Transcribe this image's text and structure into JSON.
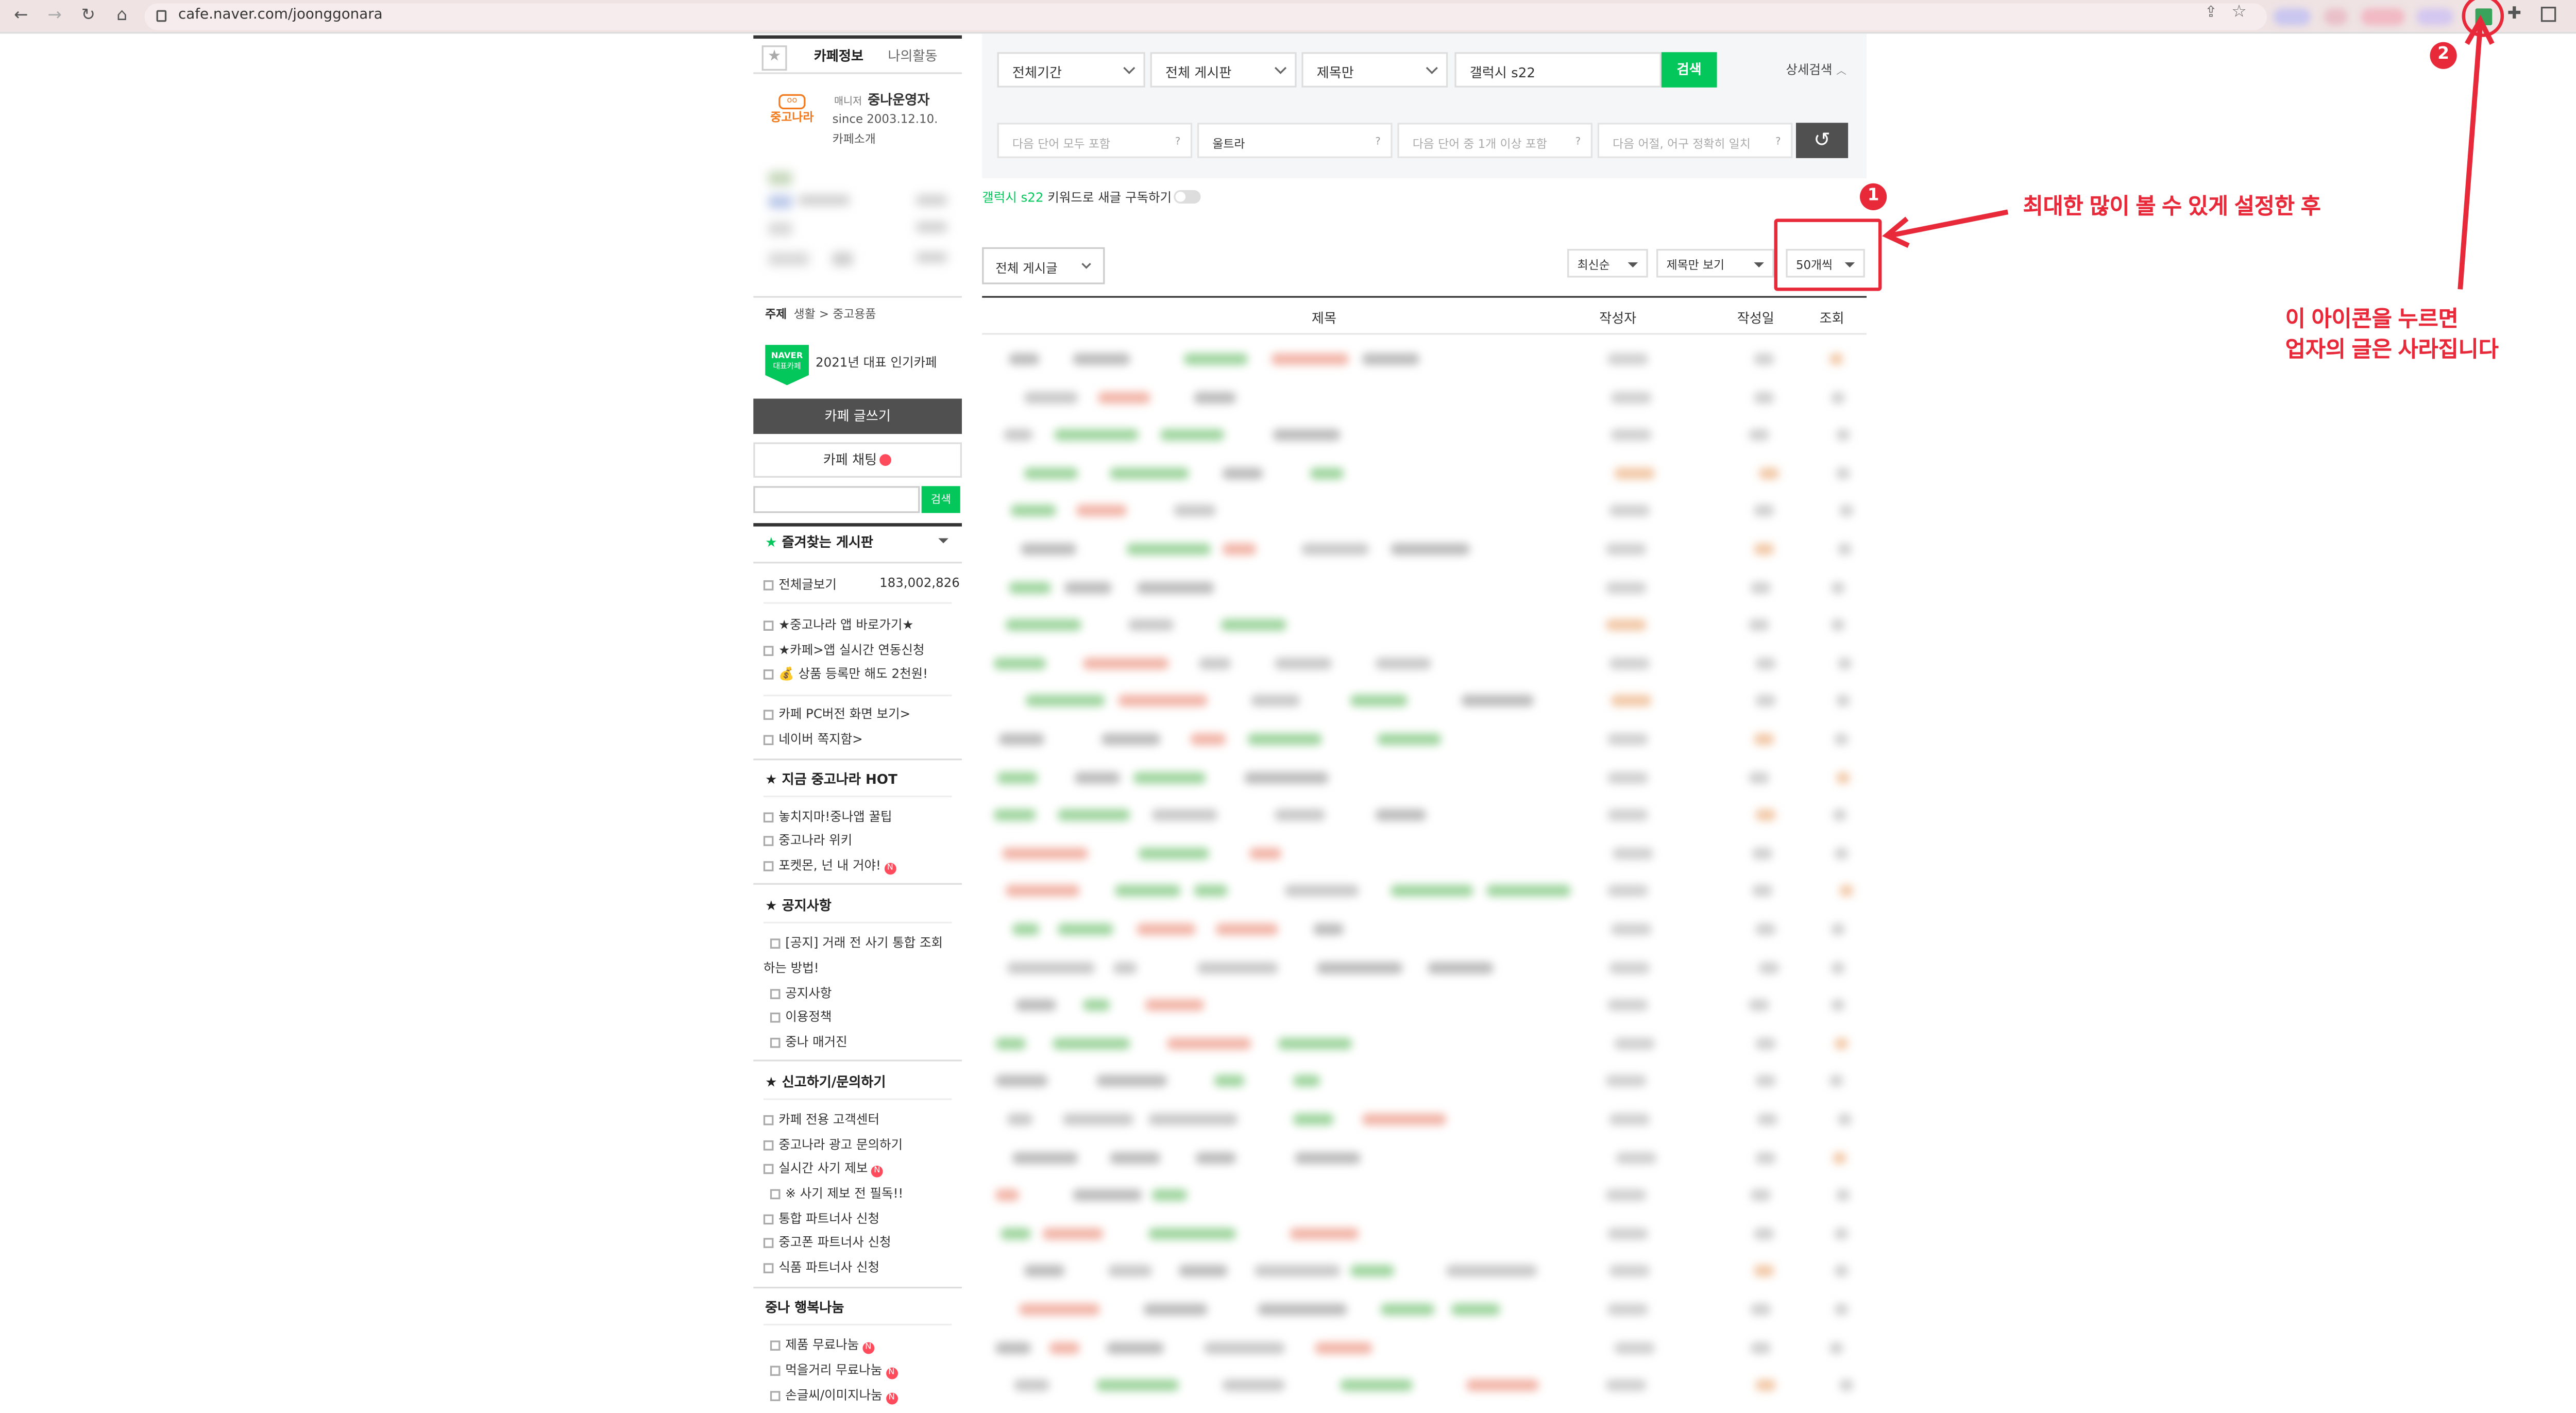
{
  "browser": {
    "url": "cafe.naver.com/joonggonara"
  },
  "sidebar": {
    "tab_cafe_info": "카페정보",
    "tab_my_activity": "나의활동",
    "manager_tag": "매니저",
    "manager_name": "중나운영자",
    "since": "since 2003.12.10.",
    "cafe_intro": "카페소개",
    "logo_text": "중고나라",
    "topic_label": "주제",
    "topic_value": "생활 > 중고용품",
    "badge_naver": "NAVER",
    "badge_sub": "대표카페",
    "popular_cafe": "2021년 대표 인기카페",
    "write_button": "카페 글쓰기",
    "chat_button": "카페 채팅",
    "search_button": "검색",
    "favorites_header": "즐겨찾는 게시판",
    "all_posts_label": "전체글보기",
    "all_posts_count": "183,002,826",
    "group1": [
      "★중고나라 앱 바로가기★",
      "★카페>앱 실시간 연동신청",
      "💰 상품 등록만 해도 2천원!"
    ],
    "group2": [
      "카페 PC버전 화면 보기>",
      "네이버 쪽지함>"
    ],
    "hot_header": "★ 지금 중고나라 HOT",
    "hot_items": [
      "놓치지마!중나앱 꿀팁",
      "중고나라 위키",
      "포켓몬, 넌 내 거야!"
    ],
    "notice_header": "★ 공지사항",
    "notice_items": [
      "[공지] 거래 전 사기 통합 조회",
      "하는 방법!",
      "공지사항",
      "이용정책",
      "중나 매거진"
    ],
    "report_header": "★ 신고하기/문의하기",
    "report_items": [
      "카페 전용 고객센터",
      "중고나라 광고 문의하기",
      "실시간 사기 제보",
      "※ 사기 제보 전 필독!!",
      "통합 파트너사 신청",
      "중고폰 파트너사 신청",
      "식품 파트너사 신청"
    ],
    "share_header": "중나 행복나눔",
    "share_items": [
      "제품 무료나눔",
      "먹을거리 무료나눔",
      "손글씨/이미지나눔"
    ]
  },
  "search": {
    "period": "전체기간",
    "board": "전체 게시판",
    "scope": "제목만",
    "query": "갤럭시 s22",
    "search_button": "검색",
    "advanced": "상세검색",
    "filter1_placeholder": "다음 단어 모두 포함",
    "filter2_value": "울트라",
    "filter3_placeholder": "다음 단어 중 1개 이상 포함",
    "filter4_placeholder": "다음 어절, 어구 정확히 일치"
  },
  "keyword_sub": {
    "keyword": "갤럭시 s22",
    "text": "키워드로 새글 구독하기"
  },
  "list_controls": {
    "board_select": "전체 게시글",
    "sort": "최신순",
    "view": "제목만 보기",
    "per_page": "50개씩"
  },
  "table_headers": {
    "title": "제목",
    "author": "작성자",
    "date": "작성일",
    "views": "조회"
  },
  "annotations": {
    "step1_number": "1",
    "step1_text": "최대한 많이 볼 수 있게 설정한 후",
    "step2_number": "2",
    "step2_line1": "이 아이콘을 누르면",
    "step2_line2": "업자의 글은 사라집니다"
  },
  "colors": {
    "accent_green": "#03c75a",
    "annotation_red": "#e8293a",
    "write_button_bg": "#505050"
  }
}
